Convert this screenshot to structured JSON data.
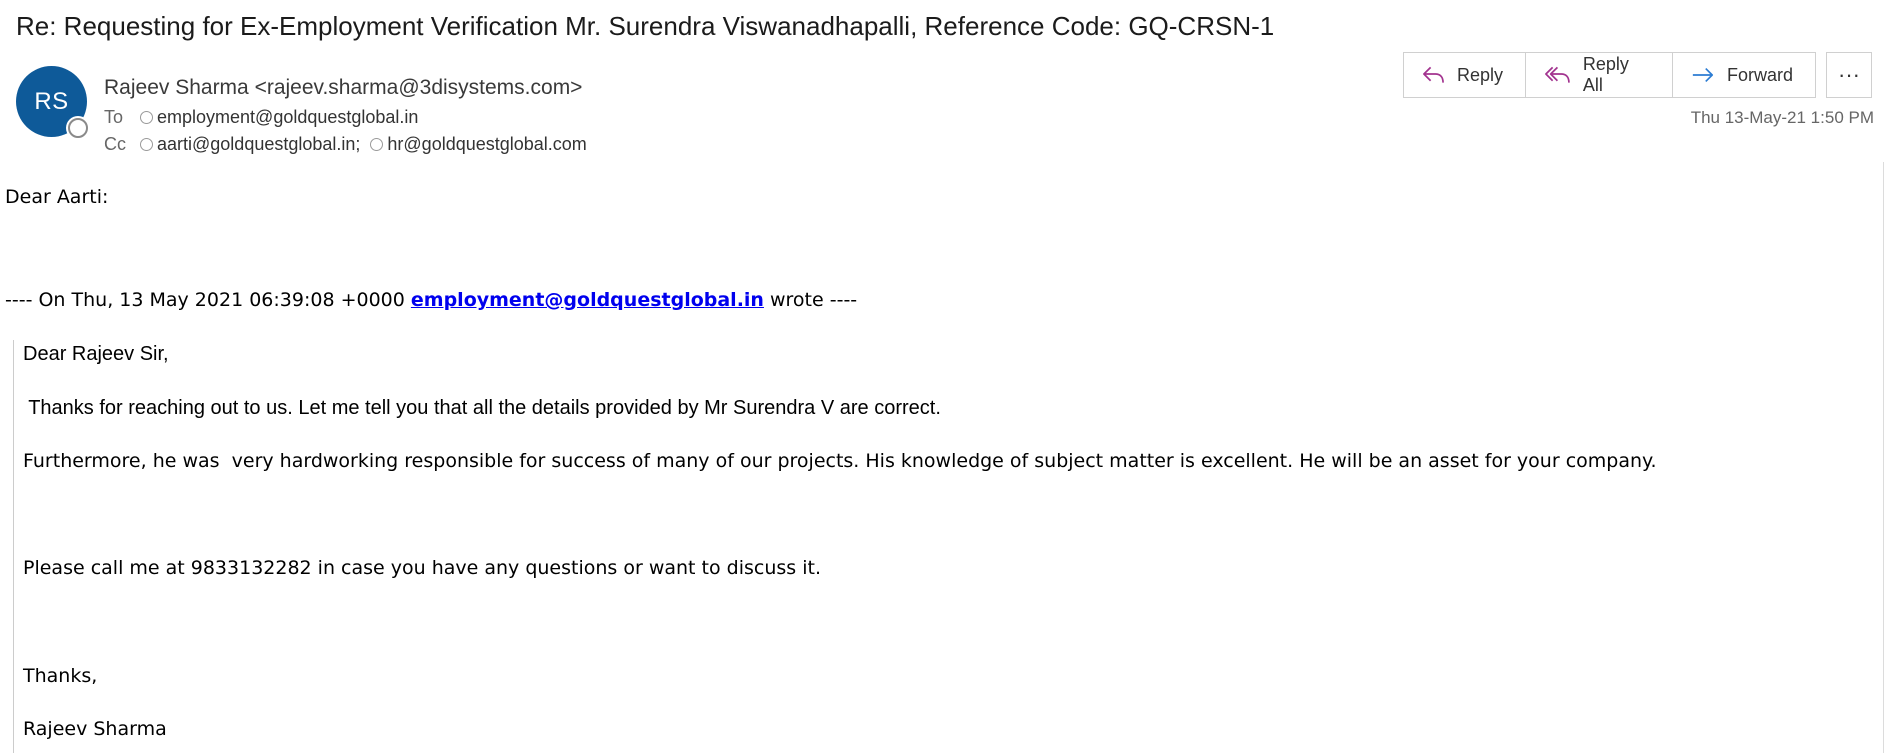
{
  "subject": "Re: Requesting for Ex-Employment Verification Mr. Surendra Viswanadhapalli, Reference Code: GQ-CRSN-1",
  "sender": {
    "initials": "RS",
    "display": "Rajeev Sharma <rajeev.sharma@3disystems.com>"
  },
  "recipients": {
    "to_label": "To",
    "to": [
      "employment@goldquestglobal.in"
    ],
    "cc_label": "Cc",
    "cc": [
      "aarti@goldquestglobal.in;",
      "hr@goldquestglobal.com"
    ]
  },
  "actions": {
    "reply": "Reply",
    "reply_all": "Reply All",
    "forward": "Forward",
    "more": "···"
  },
  "timestamp": "Thu 13-May-21 1:50 PM",
  "body": {
    "greeting": "Dear Aarti:",
    "quote_header_prefix": "---- On Thu, 13 May 2021 06:39:08 +0000 ",
    "quote_header_email": "employment@goldquestglobal.in",
    "quote_header_suffix": " wrote ----",
    "quoted": {
      "greeting": "Dear Rajeev Sir,",
      "line1": " Thanks for reaching out to us. Let me tell you that all the details provided by Mr Surendra V are correct.",
      "line2": "Furthermore, he was  very hardworking responsible for success of many of our projects. His knowledge of subject matter is excellent. He will be an asset for your company.",
      "line3": "Please call me at 9833132282 in case you have any questions or want to discuss it.",
      "closing": "Thanks,",
      "signature": "Rajeev Sharma"
    }
  },
  "colors": {
    "avatar_bg": "#0e5a99",
    "action_icon": "#a2338f",
    "forward_icon": "#2b7cd3",
    "link": "#0000ee"
  },
  "icons": [
    "reply-icon",
    "reply-all-icon",
    "forward-icon",
    "more-icon",
    "presence-icon"
  ]
}
